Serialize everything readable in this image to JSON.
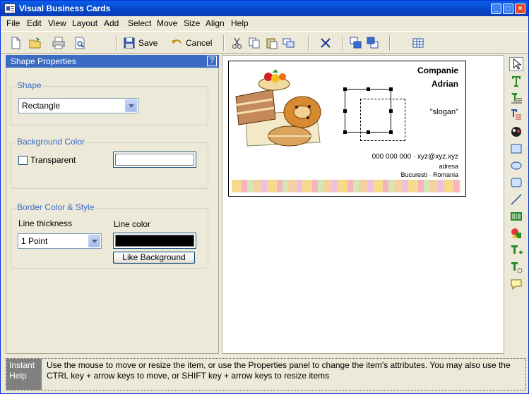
{
  "window": {
    "title": "Visual Business Cards",
    "controls": {
      "minimize": "_",
      "maximize": "□",
      "close": "×"
    }
  },
  "menubar": [
    "File",
    "Edit",
    "View",
    "Layout",
    "Add",
    "Select",
    "Move",
    "Size",
    "Align",
    "Help"
  ],
  "toolbar": {
    "save_label": "Save",
    "cancel_label": "Cancel",
    "icons": [
      "new-file-icon",
      "open-folder-icon",
      "print-icon",
      "print-preview-icon",
      "save-icon",
      "undo-icon",
      "cut-icon",
      "copy-icon",
      "paste-icon",
      "duplicate-icon",
      "delete-icon",
      "bring-front-icon",
      "send-back-icon",
      "grid-icon"
    ]
  },
  "panel": {
    "title": "Shape Properties",
    "help": "?",
    "shape": {
      "group_title": "Shape",
      "selected": "Rectangle"
    },
    "background": {
      "group_title": "Background Color",
      "transparent_label": "Transparent",
      "transparent_checked": false,
      "color": "#FFFFFF"
    },
    "border": {
      "group_title": "Border Color & Style",
      "thickness_label": "Line thickness",
      "thickness_value": "1 Point",
      "color_label": "Line color",
      "color": "#000000",
      "like_background_label": "Like Background"
    }
  },
  "card": {
    "company_line1": "Companie",
    "company_line2": "Adrian",
    "slogan": "\"slogan\"",
    "contact": "000 000 000 · xyz@xyz.xyz",
    "address": "adresa",
    "city": "Bucuresti · Romania"
  },
  "tools": [
    "pointer-icon",
    "text-tool-icon",
    "paragraph-tool-icon",
    "rich-text-icon",
    "image-tool-icon",
    "rectangle-tool-icon",
    "ellipse-tool-icon",
    "rounded-rect-tool-icon",
    "line-tool-icon",
    "barcode-icon",
    "shapes-icon",
    "add-text-icon",
    "text-effect-icon",
    "callout-icon"
  ],
  "status": {
    "header": "Instant Help",
    "message": "Use the mouse to move or resize the item, or use the Properties panel to change the item's attributes. You may also use the CTRL key + arrow keys to move, or SHIFT key + arrow keys to resize items"
  },
  "colors": {
    "accent": "#3C6BC4",
    "titlebar": "#0A5FE8",
    "face": "#ECE9D8"
  }
}
